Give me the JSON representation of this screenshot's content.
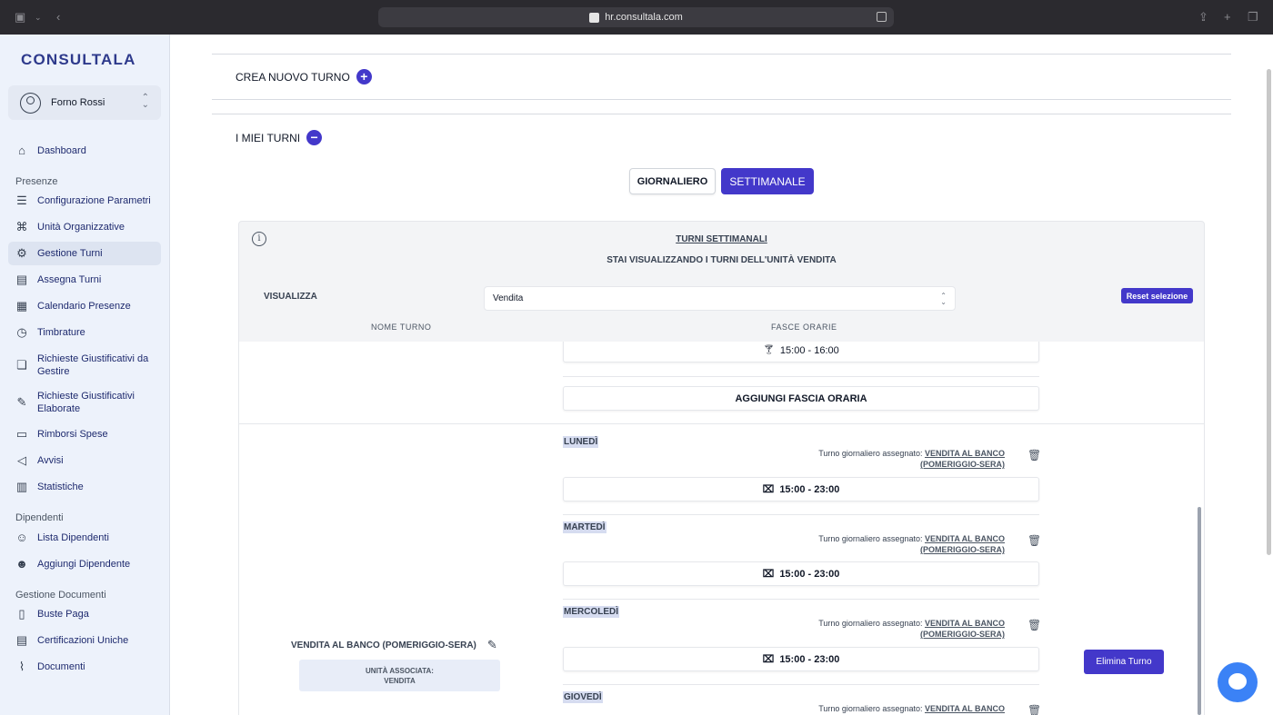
{
  "browser": {
    "url": "hr.consultala.com"
  },
  "sidebar": {
    "logo": "CONSULTALA",
    "account": "Forno Rossi",
    "items": [
      {
        "label": "Dashboard"
      },
      {
        "section": "Presenze"
      },
      {
        "label": "Configurazione Parametri"
      },
      {
        "label": "Unità Organizzative"
      },
      {
        "label": "Gestione Turni"
      },
      {
        "label": "Assegna Turni"
      },
      {
        "label": "Calendario Presenze"
      },
      {
        "label": "Timbrature"
      },
      {
        "label": "Richieste Giustificativi da Gestire"
      },
      {
        "label": "Richieste Giustificativi Elaborate"
      },
      {
        "label": "Rimborsi Spese"
      },
      {
        "label": "Avvisi"
      },
      {
        "label": "Statistiche"
      },
      {
        "section": "Dipendenti"
      },
      {
        "label": "Lista Dipendenti"
      },
      {
        "label": "Aggiungi Dipendente"
      },
      {
        "section": "Gestione Documenti"
      },
      {
        "label": "Buste Paga"
      },
      {
        "label": "Certificazioni Uniche"
      },
      {
        "label": "Documenti"
      }
    ]
  },
  "main": {
    "create_title": "CREA NUOVO TURNO",
    "my_title": "I MIEI TURNI",
    "toggle_day": "GIORNALIERO",
    "toggle_week": "SETTIMANALE",
    "panel_title": "TURNI SETTIMANALI",
    "panel_subtitle": "STAI VISUALIZZANDO I TURNI DELL'UNITÀ VENDITA",
    "visualizza": "VISUALIZZA",
    "select_value": "Vendita",
    "reset": "Reset selezione",
    "col_name": "NOME TURNO",
    "col_slots": "FASCE ORARIE",
    "prev_slot": "15:00 - 16:00",
    "add_slot": "AGGIUNGI FASCIA ORARIA",
    "shift_name": "VENDITA AL BANCO (POMERIGGIO-SERA)",
    "unit_label": "UNITÀ ASSOCIATA:",
    "unit_value": "VENDITA",
    "delete": "Elimina Turno",
    "assigned_prefix": "Turno giornaliero assegnato:",
    "assigned_link1": "VENDITA AL BANCO",
    "assigned_link2": "(POMERIGGIO-SERA)",
    "days": [
      {
        "name": "LUNEDÌ",
        "slot": "15:00 - 23:00"
      },
      {
        "name": "MARTEDÌ",
        "slot": "15:00 - 23:00"
      },
      {
        "name": "MERCOLEDÌ",
        "slot": "15:00 - 23:00"
      },
      {
        "name": "GIOVEDÌ",
        "slot": ""
      }
    ]
  }
}
